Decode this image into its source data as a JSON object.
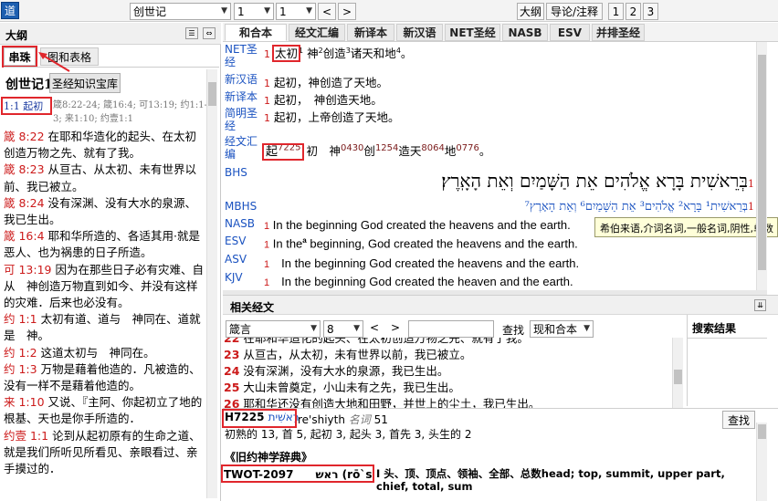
{
  "toolbar": {
    "app_icon": "道",
    "book": "创世记",
    "chapter": "1",
    "verse": "1",
    "prev": "<",
    "next": ">",
    "font_size_btn": "大纲",
    "guide_btn": "导论/注释",
    "col_buttons": [
      "1",
      "2",
      "3"
    ]
  },
  "left": {
    "header": "大纲",
    "tabs": [
      "串珠",
      "图和表格"
    ],
    "title": "创世记1",
    "kb_button": "圣经知识宝库",
    "ref_head": "1:1 起初",
    "ref_cross": "箴8:22-24; 箴16:4; 可13:19; 约1:1-3; 来1:10; 约壹1:1",
    "items": [
      {
        "ref": "箴 8:22",
        "text": "在耶和华造化的起头、在太初创造万物之先、就有了我。"
      },
      {
        "ref": "箴 8:23",
        "text": "从亘古、从太初、未有世界以前、我已被立。"
      },
      {
        "ref": "箴 8:24",
        "text": "没有深渊、没有大水的泉源、我已生出。"
      },
      {
        "ref": "箴 16:4",
        "text": "耶和华所造的、各适其用·就是恶人、也为祸患的日子所造。"
      },
      {
        "ref": "可 13:19",
        "text": "因为在那些日子必有灾难、自从　神创造万物直到如今、并没有这样的灾难．后来也必没有。"
      },
      {
        "ref": "约 1:1",
        "text": "太初有道、道与　神同在、道就是　神。"
      },
      {
        "ref": "约 1:2",
        "text": "这道太初与　神同在。"
      },
      {
        "ref": "约 1:3",
        "text": "万物是藉着他造的．凡被造的、没有一样不是藉着他造的。"
      },
      {
        "ref": "来 1:10",
        "text": "又说、『主阿、你起初立了地的根基、天也是你手所造的．"
      },
      {
        "ref": "约壹 1:1",
        "text": "论到从起初原有的生命之道、就是我们所听见所看见、亲眼看过、亲手摸过的．"
      }
    ]
  },
  "tabs": [
    "和合本",
    "经文汇编",
    "新译本",
    "新汉语",
    "NET圣经",
    "NASB",
    "ESV",
    "并排圣经"
  ],
  "verses": {
    "net": {
      "name": "NET圣经",
      "num": "1",
      "word": "太初",
      "s1": "神",
      "s2": "2",
      "s3": "创造",
      "s4": "3",
      "s5": "诸天和地",
      "s6": "4",
      "s7": "。"
    },
    "xhy": {
      "name": "新汉语",
      "num": "1",
      "text": "起初，神创造了天地。"
    },
    "xyb": {
      "name": "新译本",
      "num": "1",
      "text": "起初，　神创造天地。"
    },
    "jjsj": {
      "name": "简明圣经",
      "num": "1",
      "text": "起初，上帝创造了天地。"
    },
    "jwhb": {
      "name": "经文汇编",
      "num": "1",
      "w1": "起",
      "n1": "7225",
      "w2": "初　神",
      "n2": "0430",
      "w3": "创",
      "n3": "1254",
      "w4": "造天",
      "n4": "8064",
      "w5": "地",
      "n5": "0776",
      "w6": "。"
    },
    "bhs": {
      "name": "BHS",
      "num": "1",
      "text": "בְּרֵאשִׁית בָּרָא אֱלֹהִים אֵת הַשָּׁמַיִם וְאֵת הָאָֽרֶץ׃"
    },
    "mbhs": {
      "name": "MBHS",
      "num": "1",
      "text": "בְּרֵאשִׁית¹ בָּרָא² אֱלֹהִים³ אֵת הַשָּׁמַיִם⁶ וְאֵת הָאָרֶץ⁷"
    },
    "nasb": {
      "name": "NASB",
      "num": "1",
      "text": "In the beginning God created the heavens and the earth."
    },
    "esv": {
      "name": "ESV",
      "num": "1",
      "pre": "In the",
      "sup": "a",
      "text": " beginning, God created the heavens and the earth."
    },
    "asv": {
      "name": "ASV",
      "num": "1",
      "text": "In the beginning God created the heavens and the earth."
    },
    "kjv": {
      "name": "KJV",
      "num": "1",
      "text": "In the beginning God created the heaven and the earth."
    }
  },
  "tooltip": "希伯来语,介词名词,一般名词,阴性,单数",
  "related": {
    "header": "相关经文",
    "book": "箴言",
    "chapter": "8",
    "search_placeholder": "",
    "search_btn": "查找",
    "version": "现和合本",
    "results_header": "搜索结果",
    "lines": [
      {
        "n": "22",
        "t": "在耶和华造化的起头、在太初创造万物之先、就有了我。"
      },
      {
        "n": "23",
        "t": "从亘古，从太初，未有世界以前，我已被立。"
      },
      {
        "n": "24",
        "t": "没有深渊，没有大水的泉源，我已生出。"
      },
      {
        "n": "25",
        "t": "大山未曾奠定，小山未有之先，我已生出。"
      },
      {
        "n": "26",
        "t": "耶和华还没有创造大地和田野，并世上的尘土，我已生出。"
      }
    ]
  },
  "lexicon": {
    "code": "H7225",
    "heb": "רֵאשִׁית",
    "translit": "re'shiyth",
    "pos": "名词",
    "count": "51",
    "usage": "初熟的 13, 首 5, 起初 3, 起头 3, 首先 3, 头生的 2",
    "search_btn": "查找",
    "dict_title": "《旧约神学辞典》",
    "twot": "TWOT-2097　　ראש (rō`sh)",
    "twot_def": "I 头、顶、顶点、领袖、全部、总数head; top, summit, upper part, chief, total, sum"
  }
}
